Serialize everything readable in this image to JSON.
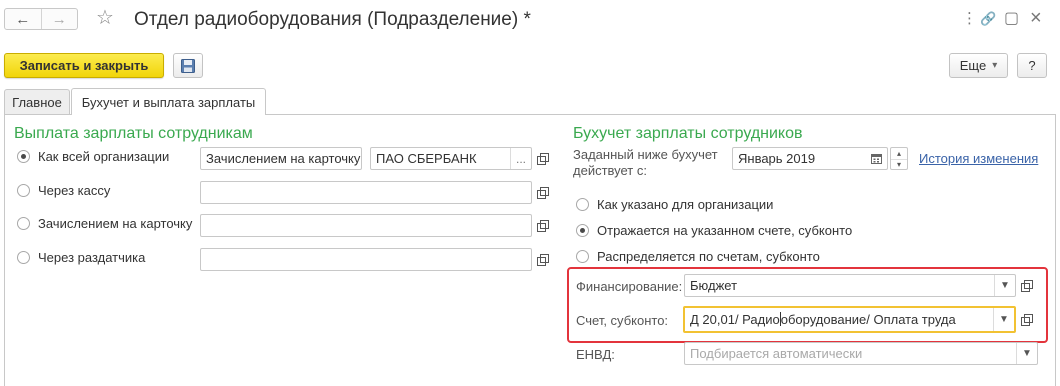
{
  "window": {
    "title": "Отдел радиоборудования (Подразделение) *",
    "nav_back": "←",
    "nav_forward": "→",
    "star": "☆",
    "menu_dots": "⋮",
    "link_icon": "🔗",
    "maximize": "▢",
    "close": "×"
  },
  "toolbar": {
    "save_close_label": "Записать и закрыть",
    "more_label": "Еще",
    "more_arrow": "▾",
    "help_label": "?"
  },
  "tabs": [
    {
      "label": "Главное",
      "active": false
    },
    {
      "label": "Бухучет и выплата зарплаты",
      "active": true
    }
  ],
  "payment": {
    "heading": "Выплата зарплаты сотрудникам",
    "options": [
      {
        "label": "Как всей организации",
        "checked": true,
        "method": "Зачислением на карточку",
        "bank": "ПАО СБЕРБАНК",
        "bank_button": "..."
      },
      {
        "label": "Через кассу",
        "checked": false,
        "value": ""
      },
      {
        "label": "Зачислением на карточку",
        "checked": false,
        "value": ""
      },
      {
        "label": "Через раздатчика",
        "checked": false,
        "value": ""
      }
    ]
  },
  "accounting": {
    "heading": "Бухучет зарплаты сотрудников",
    "effective_label_line1": "Заданный ниже бухучет",
    "effective_label_line2": "действует с:",
    "effective_date": "Январь 2019",
    "history_link": "История изменения",
    "options": [
      {
        "label": "Как указано для организации",
        "checked": false
      },
      {
        "label": "Отражается на указанном счете, субконто",
        "checked": true
      },
      {
        "label": "Распределяется по счетам, субконто",
        "checked": false
      }
    ],
    "financing_label": "Финансирование:",
    "financing_value": "Бюджет",
    "account_label": "Счет, субконто:",
    "account_value_before_caret": "Д 20,01/ Радио",
    "account_value_after_caret": "оборудование/ Оплата труда",
    "envd_label": "ЕНВД:",
    "envd_placeholder": "Подбирается автоматически"
  },
  "colors": {
    "accent_green": "#3aa94f",
    "primary_yellow": "#f1d50a",
    "highlight_red": "#e3343c",
    "focus_orange": "#f2c232",
    "link_blue": "#3a63a8"
  }
}
